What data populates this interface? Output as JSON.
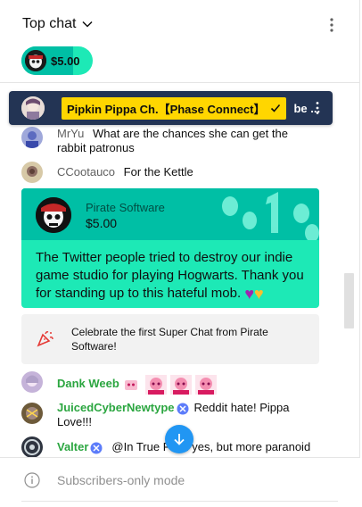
{
  "header": {
    "title": "Top chat"
  },
  "ticker": {
    "amount": "$5.00",
    "progress": 0.72,
    "color_bg": "#1de9b6",
    "color_fill": "#00bfa5"
  },
  "pinned": {
    "badge": "Pipkin Pippa Ch.【Phase Connect】",
    "text": "be ...",
    "bg_color": "#233454",
    "badge_color": "#ffd600"
  },
  "messages": [
    {
      "author": "MrYu",
      "text": "What are the chances she can get the rabbit patronus"
    },
    {
      "author": "CCootauco",
      "text": "For the Kettle"
    }
  ],
  "superchat": {
    "author": "Pirate Software",
    "amount": "$5.00",
    "text": "The Twitter people tried to destroy our indie game studio for playing Hogwarts. Thank you for standing up to this hateful mob.",
    "header_color": "#00bfa5",
    "body_color": "#1de9b6"
  },
  "celebrate": {
    "text": "Celebrate the first Super Chat from Pirate Software!"
  },
  "member_messages": [
    {
      "author": "Dank Weeb"
    },
    {
      "author": "JuicedCyberNewtype",
      "text": "Reddit hate! Pippa Love!!!"
    },
    {
      "author": "Valter",
      "text": "@In True Faith yes, but more paranoid"
    }
  ],
  "footer": {
    "text": "Subscribers-only mode"
  }
}
